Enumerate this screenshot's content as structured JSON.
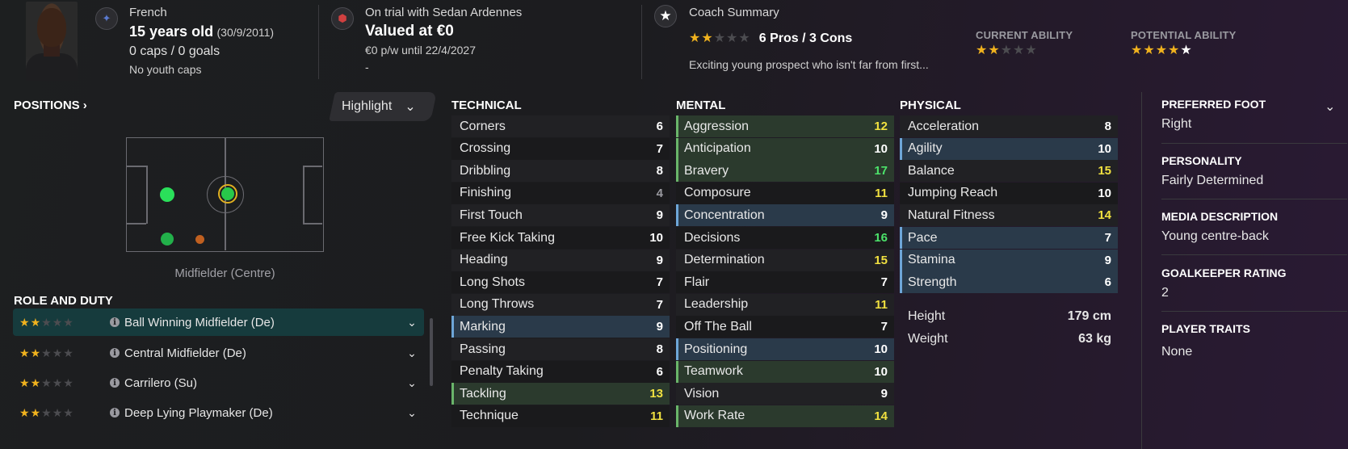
{
  "header": {
    "nationality": "French",
    "age": "15 years old",
    "dob": "(30/9/2011)",
    "caps": "0 caps / 0 goals",
    "youth_caps": "No youth caps",
    "club_status": "On trial with Sedan Ardennes",
    "value": "Valued at €0",
    "contract": "€0 p/w until 22/4/2027",
    "contract_extra": "-",
    "coach_title": "Coach Summary",
    "pros_cons": "6 Pros / 3 Cons",
    "summary_text": "Exciting young prospect who isn't far from first...",
    "coach_stars": 2,
    "current_ability_label": "CURRENT ABILITY",
    "current_ability_stars": 2,
    "potential_ability_label": "POTENTIAL ABILITY",
    "potential_ability_stars": 4.5
  },
  "positions": {
    "title": "POSITIONS",
    "chevron": "›",
    "highlight_label": "Highlight",
    "position_name": "Midfielder (Centre)"
  },
  "role_duty": {
    "title": "ROLE AND DUTY",
    "roles": [
      {
        "label": "Ball Winning Midfielder (De)",
        "stars": 2,
        "active": true
      },
      {
        "label": "Central Midfielder (De)",
        "stars": 2,
        "active": false
      },
      {
        "label": "Carrilero (Su)",
        "stars": 2,
        "active": false
      },
      {
        "label": "Deep Lying Playmaker (De)",
        "stars": 2,
        "active": false
      }
    ]
  },
  "technical": {
    "title": "TECHNICAL",
    "attrs": [
      {
        "name": "Corners",
        "value": "6"
      },
      {
        "name": "Crossing",
        "value": "7"
      },
      {
        "name": "Dribbling",
        "value": "8"
      },
      {
        "name": "Finishing",
        "value": "4"
      },
      {
        "name": "First Touch",
        "value": "9"
      },
      {
        "name": "Free Kick Taking",
        "value": "10"
      },
      {
        "name": "Heading",
        "value": "9"
      },
      {
        "name": "Long Shots",
        "value": "7"
      },
      {
        "name": "Long Throws",
        "value": "7"
      },
      {
        "name": "Marking",
        "value": "9"
      },
      {
        "name": "Passing",
        "value": "8"
      },
      {
        "name": "Penalty Taking",
        "value": "6"
      },
      {
        "name": "Tackling",
        "value": "13"
      },
      {
        "name": "Technique",
        "value": "11"
      }
    ]
  },
  "mental": {
    "title": "MENTAL",
    "attrs": [
      {
        "name": "Aggression",
        "value": "12"
      },
      {
        "name": "Anticipation",
        "value": "10"
      },
      {
        "name": "Bravery",
        "value": "17"
      },
      {
        "name": "Composure",
        "value": "11"
      },
      {
        "name": "Concentration",
        "value": "9"
      },
      {
        "name": "Decisions",
        "value": "16"
      },
      {
        "name": "Determination",
        "value": "15"
      },
      {
        "name": "Flair",
        "value": "7"
      },
      {
        "name": "Leadership",
        "value": "11"
      },
      {
        "name": "Off The Ball",
        "value": "7"
      },
      {
        "name": "Positioning",
        "value": "10"
      },
      {
        "name": "Teamwork",
        "value": "10"
      },
      {
        "name": "Vision",
        "value": "9"
      },
      {
        "name": "Work Rate",
        "value": "14"
      }
    ]
  },
  "physical": {
    "title": "PHYSICAL",
    "attrs": [
      {
        "name": "Acceleration",
        "value": "8"
      },
      {
        "name": "Agility",
        "value": "10"
      },
      {
        "name": "Balance",
        "value": "15"
      },
      {
        "name": "Jumping Reach",
        "value": "10"
      },
      {
        "name": "Natural Fitness",
        "value": "14"
      },
      {
        "name": "Pace",
        "value": "7"
      },
      {
        "name": "Stamina",
        "value": "9"
      },
      {
        "name": "Strength",
        "value": "6"
      }
    ],
    "height_label": "Height",
    "height_value": "179 cm",
    "weight_label": "Weight",
    "weight_value": "63 kg"
  },
  "info": {
    "preferred_foot_label": "PREFERRED FOOT",
    "preferred_foot": "Right",
    "personality_label": "PERSONALITY",
    "personality": "Fairly Determined",
    "media_label": "MEDIA DESCRIPTION",
    "media": "Young centre-back",
    "gk_label": "GOALKEEPER RATING",
    "gk": "2",
    "traits_label": "PLAYER TRAITS",
    "traits": "None"
  },
  "colors": {
    "accent_green": "#4ce26a",
    "accent_yellow": "#f0e040",
    "star": "#f0b21e",
    "highlight_blue": "#6ea6d8"
  }
}
